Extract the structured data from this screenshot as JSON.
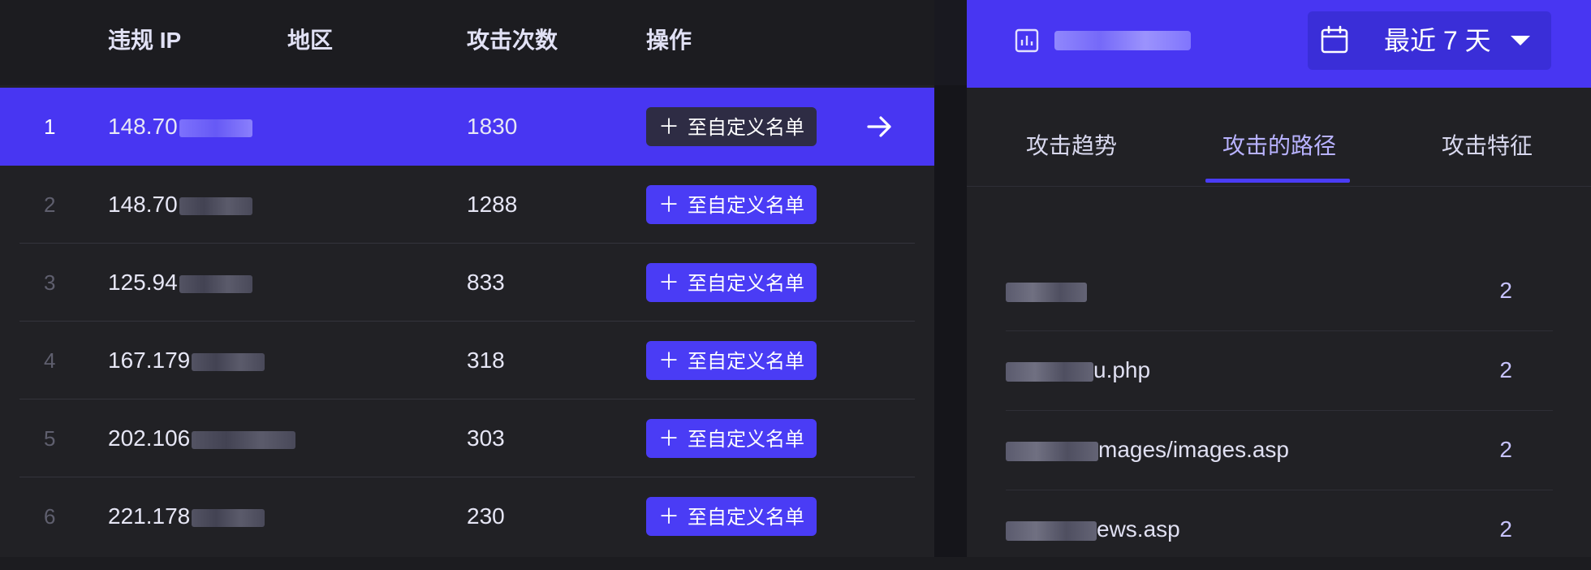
{
  "table": {
    "headers": {
      "ip": "违规 IP",
      "region": "地区",
      "count": "攻击次数",
      "action": "操作"
    },
    "rows": [
      {
        "num": "1",
        "ip": "148.70",
        "count": "1830",
        "action": "至自定义名单"
      },
      {
        "num": "2",
        "ip": "148.70",
        "count": "1288",
        "action": "至自定义名单"
      },
      {
        "num": "3",
        "ip": "125.94",
        "count": "833",
        "action": "至自定义名单"
      },
      {
        "num": "4",
        "ip": "167.179",
        "count": "318",
        "action": "至自定义名单"
      },
      {
        "num": "5",
        "ip": "202.106",
        "count": "303",
        "action": "至自定义名单"
      },
      {
        "num": "6",
        "ip": "221.178",
        "count": "230",
        "action": "至自定义名单"
      }
    ],
    "selected_row": 1
  },
  "panel": {
    "range_label": "最近 7 天",
    "tabs": [
      "攻击趋势",
      "攻击的路径",
      "攻击特征"
    ],
    "active_tab": 1,
    "paths": [
      {
        "visible": "",
        "count": "2"
      },
      {
        "visible": "u.php",
        "count": "2"
      },
      {
        "visible": "mages/images.asp",
        "count": "2"
      },
      {
        "visible": "ews.asp",
        "count": "2"
      }
    ]
  },
  "icons": {
    "add": "plus-icon",
    "go": "arrow-right-icon",
    "site": "bar-chart-icon",
    "calendar": "calendar-icon",
    "dropdown": "caret-down-icon"
  },
  "colors": {
    "accent": "#4836f2",
    "button": "#4a3cf5",
    "panel_bg": "#212125"
  }
}
